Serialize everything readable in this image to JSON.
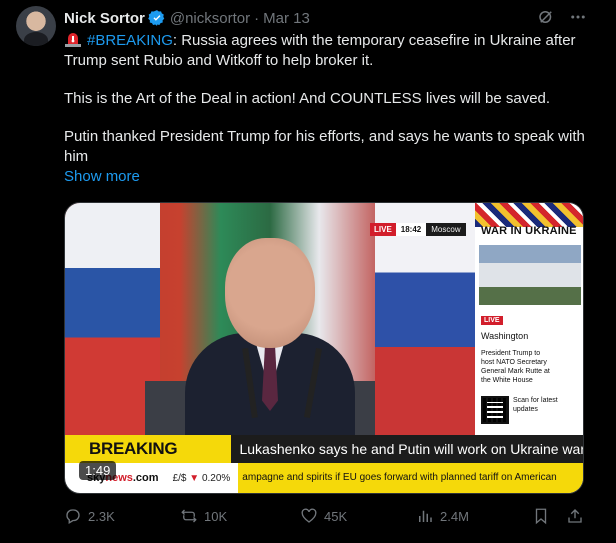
{
  "tweet": {
    "author_name": "Nick Sortor",
    "author_handle": "@nicksortor",
    "separator": "·",
    "date": "Mar 13",
    "hashtag": "#BREAKING",
    "line1_rest": ": Russia agrees with the temporary ceasefire in Ukraine after Trump sent Rubio and Witkoff to help broker it.",
    "paragraph2": "This is the Art of the Deal in action! And COUNTLESS lives will be saved.",
    "paragraph3": "Putin thanked President Trump for his efforts, and says he wants to speak with him",
    "show_more": "Show more"
  },
  "media": {
    "live_label": "LIVE",
    "live_time": "18:42",
    "live_location": "Moscow",
    "sidebar_title": "WAR IN UKRAINE",
    "sidebar_live": "LIVE",
    "sidebar_location": "Washington",
    "sidebar_desc": "President Trump to host NATO Secretary General Mark Rutte at the White House",
    "sidebar_scan": "Scan for latest updates",
    "breaking_label": "BREAKING NEWS",
    "breaking_text": "Lukashenko says he and Putin will work on Ukraine war",
    "sky_logo_a": "sky",
    "sky_logo_b": "news",
    "sky_logo_c": ".com",
    "fx_pair": "£/$",
    "fx_arrow": "▼",
    "fx_value": "0.20%",
    "ticker_text": "ampagne and spirits if EU goes forward with planned tariff on American",
    "duration": "1:49"
  },
  "actions": {
    "replies": "2.3K",
    "reposts": "10K",
    "likes": "45K",
    "views": "2.4M"
  },
  "colors": {
    "accent": "#1d9bf0",
    "muted": "#71767b",
    "breaking_yellow": "#f5d90a",
    "sky_red": "#d21e2b"
  }
}
